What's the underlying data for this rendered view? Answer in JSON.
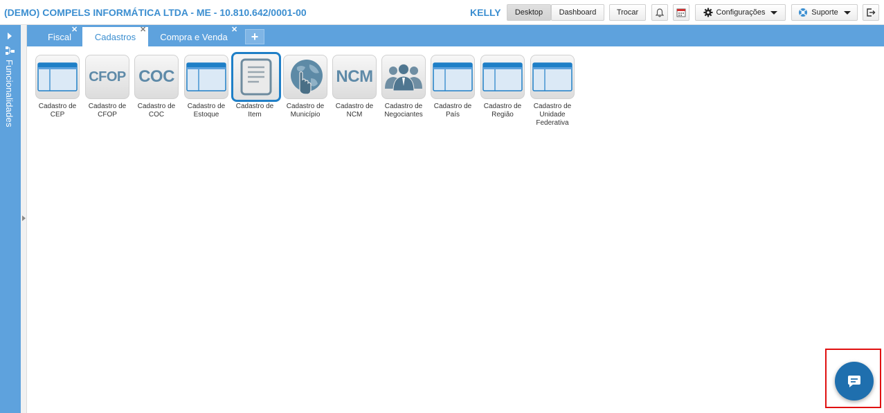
{
  "header": {
    "company": "(DEMO) COMPELS INFORMÁTICA LTDA - ME - 10.810.642/0001-00",
    "user": "KELLY",
    "desktop_label": "Desktop",
    "dashboard_label": "Dashboard",
    "trocar_label": "Trocar",
    "notification_icon": "bell-icon",
    "calendar_icon": "calendar-icon",
    "config_label": "Configurações",
    "support_label": "Suporte",
    "logout_icon": "logout-icon"
  },
  "sidebar": {
    "label": "Funcionalidades"
  },
  "tabs": [
    {
      "label": "Fiscal",
      "active": false
    },
    {
      "label": "Cadastros",
      "active": true
    },
    {
      "label": "Compra e Venda",
      "active": false
    }
  ],
  "tab_close_glyph": "✕",
  "tab_add_glyph": "+",
  "apps": [
    {
      "label": "Cadastro de CEP",
      "icon": "window-icon"
    },
    {
      "label": "Cadastro de CFOP",
      "icon_text": "CFOP"
    },
    {
      "label": "Cadastro de COC",
      "icon_text": "COC"
    },
    {
      "label": "Cadastro de Estoque",
      "icon": "window-icon"
    },
    {
      "label": "Cadastro de Item",
      "icon": "document-icon",
      "selected": true
    },
    {
      "label": "Cadastro de Município",
      "icon": "globe-hand-icon"
    },
    {
      "label": "Cadastro de NCM",
      "icon_text": "NCM"
    },
    {
      "label": "Cadastro de Negociantes",
      "icon": "people-icon"
    },
    {
      "label": "Cadastro de País",
      "icon": "window-icon"
    },
    {
      "label": "Cadastro de Região",
      "icon": "window-icon"
    },
    {
      "label": "Cadastro de Unidade Federativa",
      "icon": "window-icon"
    }
  ],
  "colors": {
    "accent": "#3b8ed0",
    "bar": "#5ea2dd",
    "chat": "#1f6fae",
    "highlight": "#e01010"
  }
}
